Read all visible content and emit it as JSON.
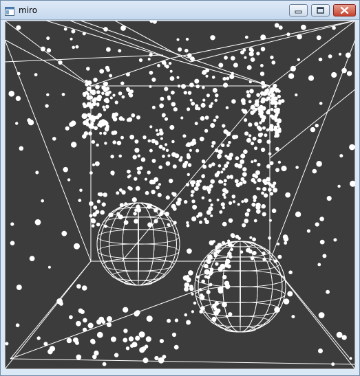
{
  "window": {
    "title": "miro",
    "controls": {
      "minimize_icon": "minimize-icon",
      "maximize_icon": "maximize-icon",
      "close_icon": "close-icon"
    },
    "colors": {
      "canvas_bg": "#3c3c3c",
      "particle": "#ffffff",
      "close_red": "#c3412d",
      "frame": "#dbe8f5"
    }
  },
  "scene": {
    "spheres": 2,
    "box": "wireframe-cube",
    "particles": "white-dots"
  }
}
